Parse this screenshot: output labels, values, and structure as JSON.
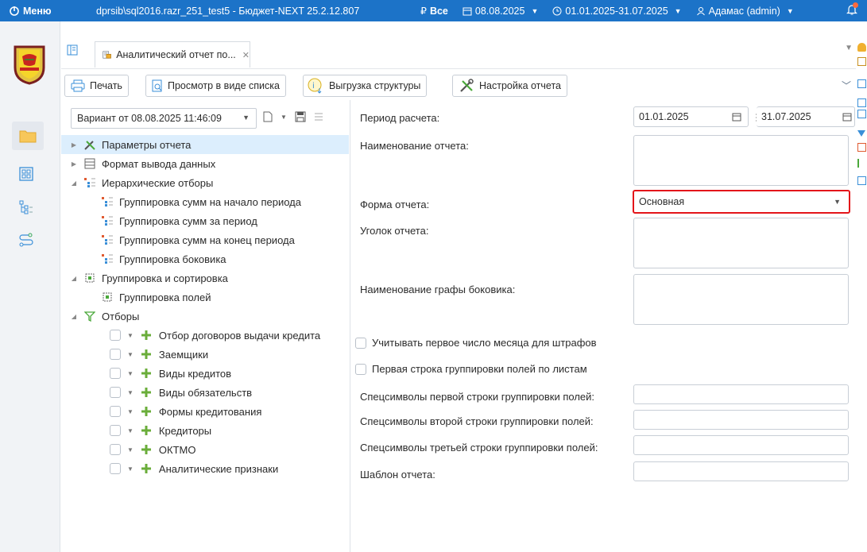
{
  "titlebar": {
    "menu_label": "Меню",
    "app_title": "dprsib\\sql2016.razr_251_test5 - Бюджет-NEXT 25.2.12.807",
    "currency_label": "Все",
    "date_label": "08.08.2025",
    "period_label": "01.01.2025-31.07.2025",
    "user_label": "Адамас (admin)"
  },
  "tabs": {
    "active_tab_label": "Аналитический отчет по..."
  },
  "toolbar": {
    "print_label": "Печать",
    "list_view_label": "Просмотр в виде списка",
    "export_label": "Выгрузка структуры",
    "settings_label": "Настройка отчета"
  },
  "variant": {
    "selected": "Вариант от 08.08.2025 11:46:09"
  },
  "tree": {
    "params": "Параметры отчета",
    "output_format": "Формат вывода данных",
    "hier_filters": "Иерархические отборы",
    "group_start": "Группировка сумм на начало периода",
    "group_period": "Группировка сумм за период",
    "group_end": "Группировка сумм на конец периода",
    "group_side": "Группировка боковика",
    "group_sort": "Группировка и сортировка",
    "group_fields": "Группировка полей",
    "filters": "Отборы",
    "filter_items": [
      "Отбор договоров выдачи кредита",
      "Заемщики",
      "Виды кредитов",
      "Виды обязательств",
      "Формы кредитования",
      "Кредиторы",
      "ОКТМО",
      "Аналитические признаки"
    ]
  },
  "form": {
    "period_label": "Период расчета:",
    "date_from": "01.01.2025",
    "date_to": "31.07.2025",
    "report_name_label": "Наименование отчета:",
    "report_name_value": "",
    "report_form_label": "Форма отчета:",
    "report_form_value": "Основная",
    "corner_label": "Уголок отчета:",
    "sidecol_label": "Наименование графы боковика:",
    "cb_first_day": "Учитывать первое число месяца для штрафов",
    "cb_first_row": "Первая строка группировки полей по листам",
    "spec1_label": "Спецсимволы первой строки группировки полей:",
    "spec2_label": "Спецсимволы второй строки группировки полей:",
    "spec3_label": "Спецсимволы третьей строки группировки полей:",
    "template_label": "Шаблон отчета:"
  },
  "colors": {
    "titlebar_bg": "#1c73c8",
    "highlight_border": "#e3151a",
    "selected_row_bg": "#dceefd",
    "plus_icon": "#6aad3a"
  }
}
